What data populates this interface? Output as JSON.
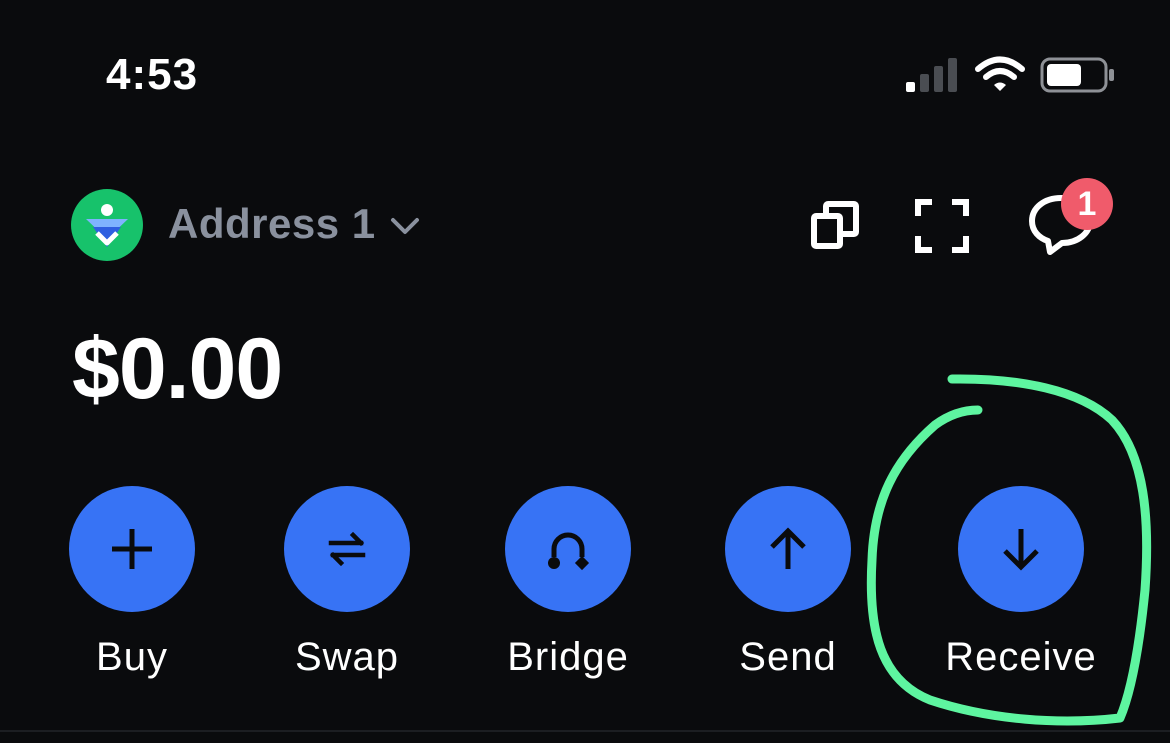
{
  "status_bar": {
    "time": "4:53",
    "signal_icon": "cellular-signal-icon",
    "wifi_icon": "wifi-icon",
    "battery_icon": "battery-icon"
  },
  "header": {
    "avatar_icon": "wallet-avatar-icon",
    "address_label": "Address 1",
    "dropdown_icon": "chevron-down-icon",
    "copy_icon": "copy-icon",
    "scan_icon": "scan-icon",
    "messages_icon": "chat-bubble-icon",
    "messages_badge": "1"
  },
  "balance": {
    "amount": "$0.00"
  },
  "actions": [
    {
      "label": "Buy",
      "icon": "plus-icon"
    },
    {
      "label": "Swap",
      "icon": "swap-arrows-icon"
    },
    {
      "label": "Bridge",
      "icon": "bridge-icon"
    },
    {
      "label": "Send",
      "icon": "arrow-up-icon"
    },
    {
      "label": "Receive",
      "icon": "arrow-down-icon"
    }
  ],
  "colors": {
    "background": "#0a0b0d",
    "action_blue": "#3773f5",
    "avatar_green": "#17c26b",
    "badge_red": "#f05b6b",
    "annotation_green": "#5ef5a0",
    "muted_text": "#8a919e"
  }
}
